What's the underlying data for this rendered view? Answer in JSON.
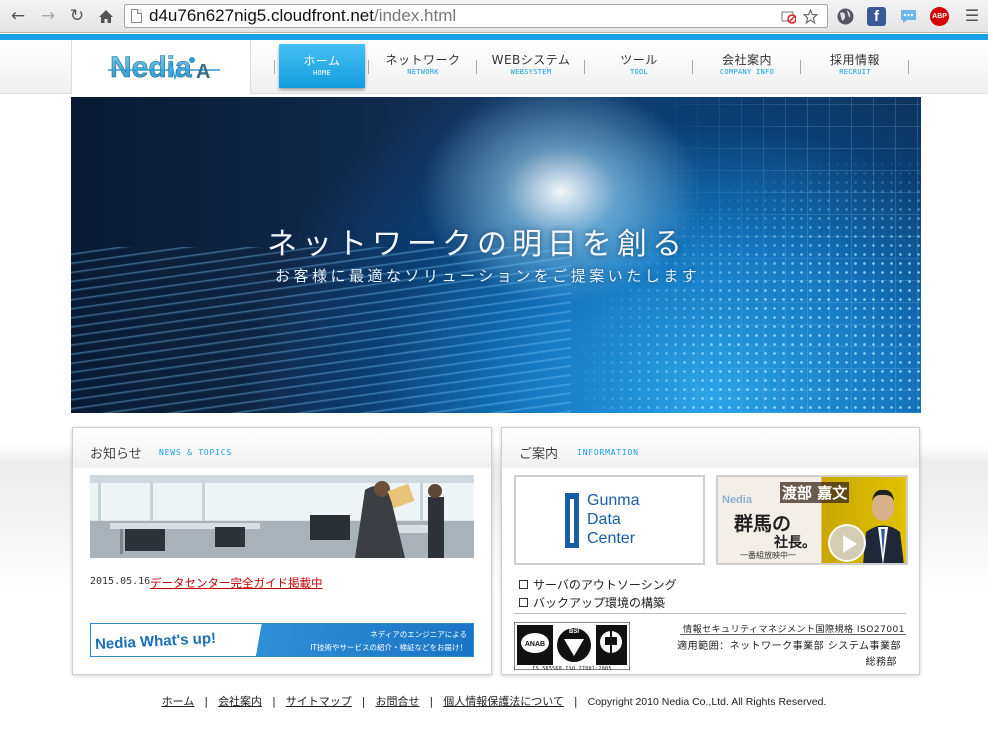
{
  "browser": {
    "url_host": "d4u76n627nig5.cloudfront.net",
    "url_path": "/index.html",
    "ext_abp": "ABP"
  },
  "site": {
    "logo_text": "Nedia",
    "nav": [
      {
        "jp": "ホーム",
        "en": "HOME",
        "active": true
      },
      {
        "jp": "ネットワーク",
        "en": "NETWORK",
        "active": false
      },
      {
        "jp": "WEBシステム",
        "en": "WEBSYSTEM",
        "active": false
      },
      {
        "jp": "ツール",
        "en": "TOOL",
        "active": false
      },
      {
        "jp": "会社案内",
        "en": "COMPANY INFO",
        "active": false
      },
      {
        "jp": "採用情報",
        "en": "RECRUIT",
        "active": false
      }
    ]
  },
  "hero": {
    "title": "ネットワークの明日を創る",
    "subtitle": "お客様に最適なソリューションをご提案いたします"
  },
  "news": {
    "title": "お知らせ",
    "subtitle": "NEWS & TOPICS",
    "items": [
      {
        "date": "2015.05.16",
        "text": "データセンター完全ガイド掲載中"
      }
    ],
    "banner_title": "Nedia What's up!",
    "banner_line1": "ネディアのエンジニアによる",
    "banner_line2": "IT技術やサービスの紹介・検証などをお届け！"
  },
  "info": {
    "title": "ご案内",
    "subtitle": "INFORMATION",
    "gunma_lines": [
      "Gunma",
      "Data",
      "Center"
    ],
    "shacho_brand": "Nedia",
    "shacho_name": "渡部 嘉文",
    "shacho_k1": "群馬の",
    "shacho_k2": "社長。",
    "shacho_k3": "一番組放映中一",
    "services": [
      "サーバのアウトソーシング",
      "バックアップ環境の構築"
    ],
    "iso_caption": "IS 565568   ISO 27001:2005",
    "iso_title": "情報セキュリティマネジメント国際規格 ISO27001",
    "iso_scope": "適用範囲：ネットワーク事業部 システム事業部",
    "iso_dept": "総務部"
  },
  "footer": {
    "links": [
      "ホーム",
      "会社案内",
      "サイトマップ",
      "お問合せ",
      "個人情報保護法について"
    ],
    "copyright": "Copyright 2010 Nedia Co.,Ltd. All Rights Reserved."
  },
  "colors": {
    "accent": "#17a1e6",
    "link_red": "#c00000",
    "brand_blue": "#1a5da6"
  }
}
